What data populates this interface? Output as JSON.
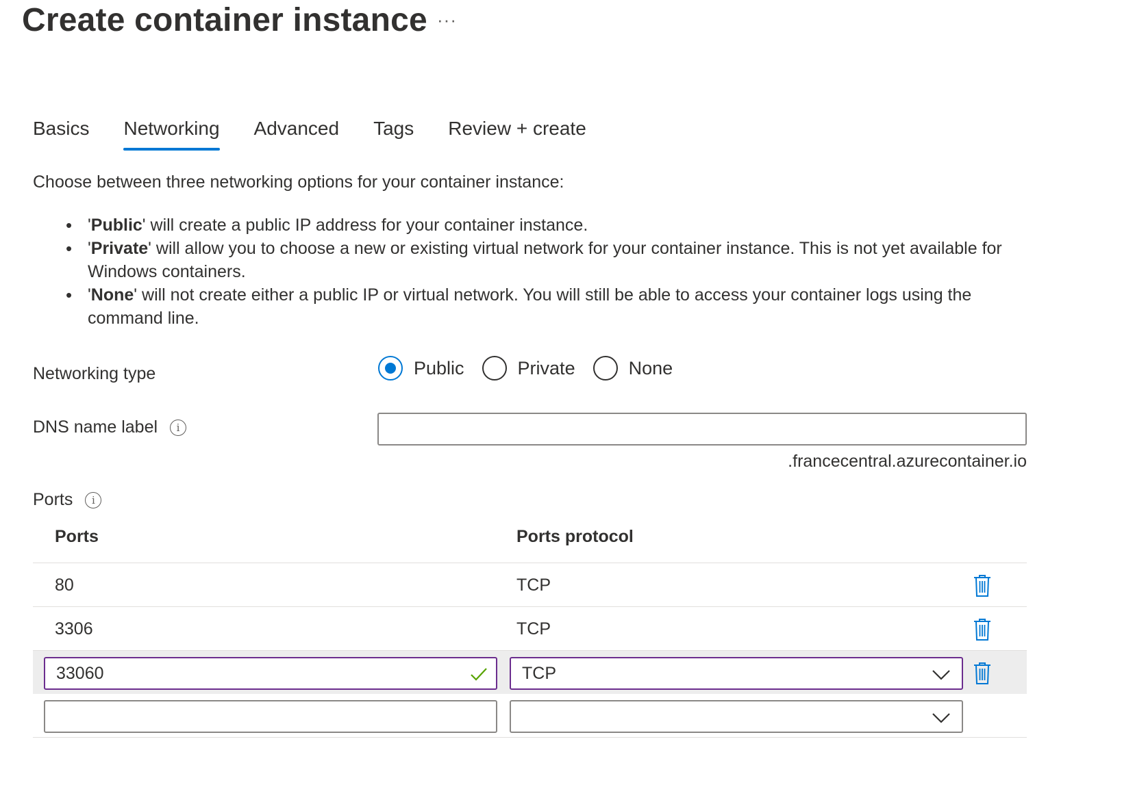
{
  "header": {
    "title": "Create container instance",
    "more_label": "···"
  },
  "tabs": [
    {
      "label": "Basics",
      "active": false
    },
    {
      "label": "Networking",
      "active": true
    },
    {
      "label": "Advanced",
      "active": false
    },
    {
      "label": "Tags",
      "active": false
    },
    {
      "label": "Review + create",
      "active": false
    }
  ],
  "intro": "Choose between three networking options for your container instance:",
  "bullets": [
    {
      "bold": "Public",
      "text": " will create a public IP address for your container instance."
    },
    {
      "bold": "Private",
      "text": " will allow you to choose a new or existing virtual network for your container instance. This is not yet available for Windows containers."
    },
    {
      "bold": "None",
      "text": " will not create either a public IP or virtual network. You will still be able to access your container logs using the command line."
    }
  ],
  "networking_type": {
    "label": "Networking type",
    "options": [
      "Public",
      "Private",
      "None"
    ],
    "selected": "Public"
  },
  "dns": {
    "label": "DNS name label",
    "value": "",
    "suffix": ".francecentral.azurecontainer.io"
  },
  "ports": {
    "label": "Ports",
    "col_ports": "Ports",
    "col_protocol": "Ports protocol",
    "rows": [
      {
        "port": "80",
        "protocol": "TCP"
      },
      {
        "port": "3306",
        "protocol": "TCP"
      }
    ],
    "edit_row": {
      "port": "33060",
      "protocol": "TCP"
    },
    "new_row": {
      "port": "",
      "protocol": ""
    }
  },
  "colors": {
    "accent": "#0078d4",
    "focus_border": "#6b2d8e",
    "valid": "#57a300"
  },
  "icons": [
    "more-icon",
    "info-icon",
    "delete-icon",
    "checkmark-icon",
    "chevron-down-icon"
  ]
}
